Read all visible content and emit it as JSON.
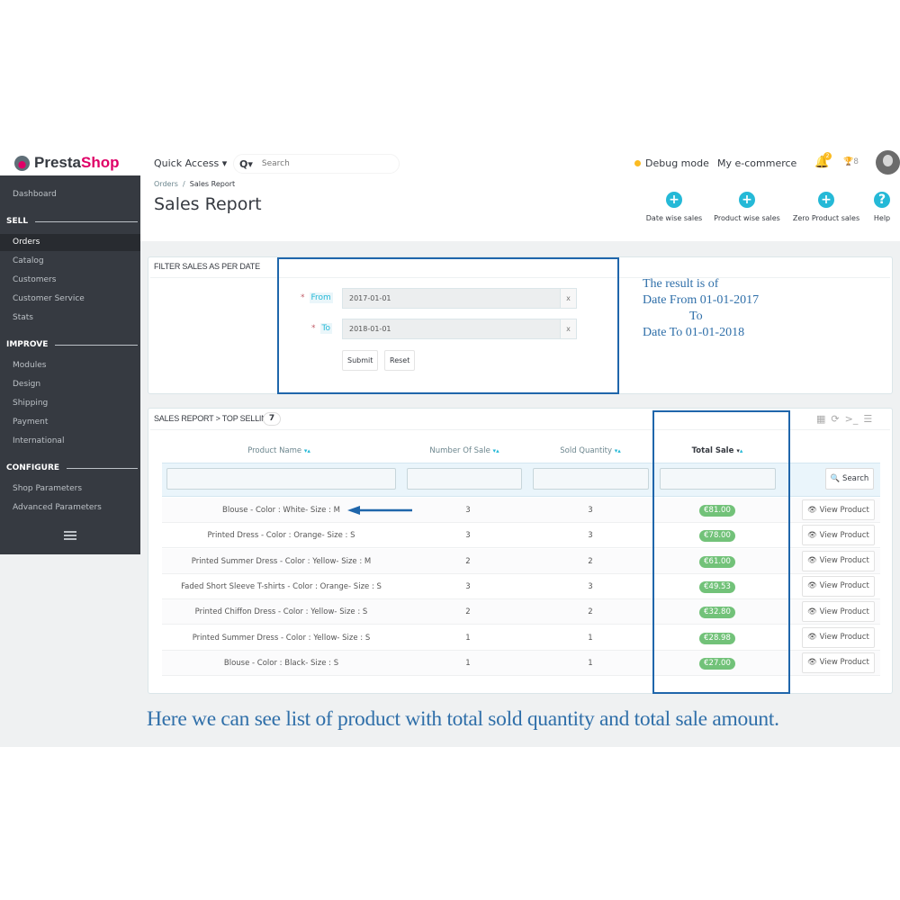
{
  "app": {
    "logo_pre": "Presta",
    "logo_post": "Shop",
    "quick_access": "Quick Access ▾",
    "search_prefix": "Q▾",
    "search_placeholder": "Search",
    "debug_label": "Debug mode",
    "shop_name": "My e-commerce",
    "notif_count": "2",
    "trophy_count": "8"
  },
  "sidebar": {
    "dashboard": "Dashboard",
    "sections": [
      {
        "title": "SELL",
        "items": [
          "Orders",
          "Catalog",
          "Customers",
          "Customer Service",
          "Stats"
        ]
      },
      {
        "title": "IMPROVE",
        "items": [
          "Modules",
          "Design",
          "Shipping",
          "Payment",
          "International"
        ]
      },
      {
        "title": "CONFIGURE",
        "items": [
          "Shop Parameters",
          "Advanced Parameters"
        ]
      }
    ],
    "active": "Orders"
  },
  "header": {
    "breadcrumb_parent": "Orders",
    "breadcrumb_sep": "/",
    "breadcrumb_current": "Sales Report",
    "title": "Sales Report",
    "toolbar": [
      {
        "label": "Date wise sales",
        "icon": "plus-circle-icon"
      },
      {
        "label": "Product wise sales",
        "icon": "plus-circle-icon"
      },
      {
        "label": "Zero Product sales",
        "icon": "plus-circle-icon"
      },
      {
        "label": "Help",
        "icon": "help-circle-icon"
      }
    ]
  },
  "filter_panel": {
    "title": "FILTER SALES AS PER DATE",
    "required_mark": "*",
    "from_label": "From",
    "from_value": "2017-01-01",
    "to_label": "To",
    "to_value": "2018-01-01",
    "clear": "x",
    "submit": "Submit",
    "reset": "Reset"
  },
  "annotation": {
    "line1": "The result is of",
    "line2": "Date From 01-01-2017",
    "line3": "To",
    "line4": "Date To 01-01-2018"
  },
  "report": {
    "title": "SALES REPORT > TOP SELLING",
    "count": "7",
    "columns": [
      "Product Name",
      "Number Of Sale",
      "Sold Quantity",
      "Total Sale"
    ],
    "sort_desc": "▾",
    "sort_asc": "▴",
    "search_button": "Search",
    "view_button": "View Product",
    "rows": [
      {
        "name": "Blouse - Color : White- Size : M",
        "sales": "3",
        "qty": "3",
        "total": "€81.00"
      },
      {
        "name": "Printed Dress - Color : Orange- Size : S",
        "sales": "3",
        "qty": "3",
        "total": "€78.00"
      },
      {
        "name": "Printed Summer Dress - Color : Yellow- Size : M",
        "sales": "2",
        "qty": "2",
        "total": "€61.00"
      },
      {
        "name": "Faded Short Sleeve T-shirts - Color : Orange- Size : S",
        "sales": "3",
        "qty": "3",
        "total": "€49.53"
      },
      {
        "name": "Printed Chiffon Dress - Color : Yellow- Size : S",
        "sales": "2",
        "qty": "2",
        "total": "€32.80"
      },
      {
        "name": "Printed Summer Dress - Color : Yellow- Size : S",
        "sales": "1",
        "qty": "1",
        "total": "€28.98"
      },
      {
        "name": "Blouse - Color : Black- Size : S",
        "sales": "1",
        "qty": "1",
        "total": "€27.00"
      }
    ]
  },
  "caption": "Here we can see list of product with total sold quantity and total sale amount.",
  "colors": {
    "accent": "#25b9d7",
    "sidebar": "#363a41",
    "price_badge": "#72c279",
    "annotation": "#1f66ab",
    "brand": "#df0067"
  }
}
